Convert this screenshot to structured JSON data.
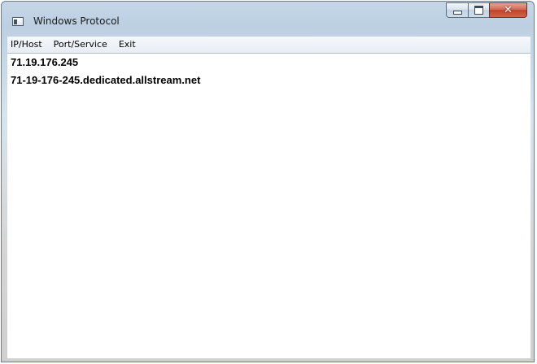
{
  "window": {
    "title": "Windows Protocol",
    "controls": {
      "minimize": "minimize",
      "maximize": "maximize",
      "close": "✕"
    }
  },
  "menu": {
    "items": [
      "IP/Host",
      "Port/Service",
      "Exit"
    ]
  },
  "content": {
    "lines": [
      "71.19.176.245",
      "71-19-176-245.dedicated.allstream.net"
    ]
  }
}
